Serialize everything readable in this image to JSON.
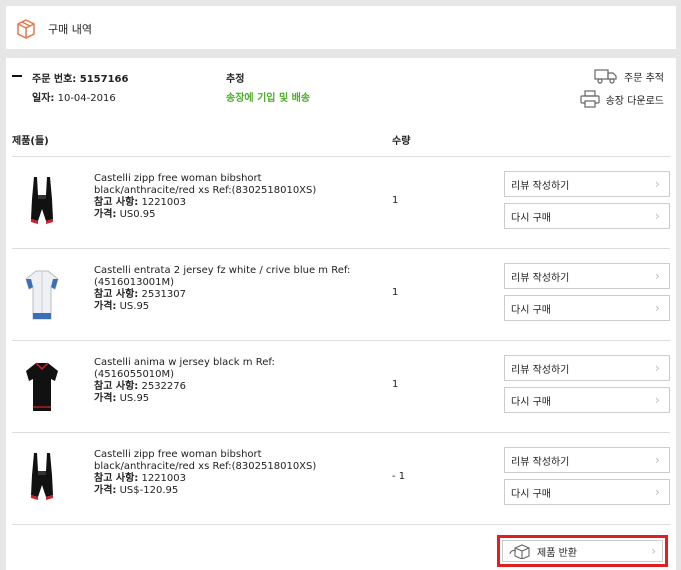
{
  "header": {
    "title": "구매 내역"
  },
  "order": {
    "number_label": "주문 번호:",
    "number": "5157166",
    "date_label": "일자:",
    "date": "10-04-2016",
    "tracking_label": "추정",
    "tracking_status": "송장에 기입 및 배송",
    "track_action": "주문 추적",
    "invoice_action": "송장 다운로드"
  },
  "columns": {
    "products": "제품(들)",
    "quantity": "수량"
  },
  "items": [
    {
      "name": "Castelli zipp free woman bibshort black/anthracite/red xs Ref:(8302518010XS)",
      "ref_label": "참고 사항:",
      "ref": "1221003",
      "price_label": "가격:",
      "price": "US0.95",
      "quantity": "1",
      "thumb": "bibshort"
    },
    {
      "name": "Castelli entrata 2 jersey fz white / crive blue m Ref:(4516013001M)",
      "ref_label": "참고 사항:",
      "ref": "2531307",
      "price_label": "가격:",
      "price": "US.95",
      "quantity": "1",
      "thumb": "jersey-white"
    },
    {
      "name": "Castelli anima w jersey black m Ref:(4516055010M)",
      "ref_label": "참고 사항:",
      "ref": "2532276",
      "price_label": "가격:",
      "price": "US.95",
      "quantity": "1",
      "thumb": "jersey-black"
    },
    {
      "name": "Castelli zipp free woman bibshort black/anthracite/red xs Ref:(8302518010XS)",
      "ref_label": "참고 사항:",
      "ref": "1221003",
      "price_label": "가격:",
      "price": "US$-120.95",
      "quantity": "- 1",
      "thumb": "bibshort"
    }
  ],
  "buttons": {
    "review": "리뷰 작성하기",
    "rebuy": "다시 구매",
    "return": "제품 반환"
  },
  "colors": {
    "accent_red": "#e02020",
    "status_green": "#4caf28",
    "icon_orange": "#e8774a"
  }
}
